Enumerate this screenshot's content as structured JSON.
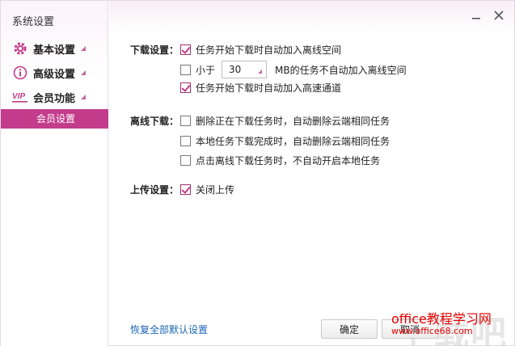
{
  "window": {
    "title": "系统设置"
  },
  "sidebar": {
    "items": [
      {
        "label": "基本设置"
      },
      {
        "label": "高级设置"
      },
      {
        "label": "会员功能"
      }
    ],
    "sub_items": [
      {
        "label": "会员设置"
      }
    ]
  },
  "settings": {
    "download": {
      "label": "下载设置：",
      "opt1": {
        "text": "任务开始下载时自动加入离线空间",
        "checked": true
      },
      "opt2": {
        "prefix": "小于",
        "value": "30",
        "suffix": "MB的任务不自动加入离线空间",
        "checked": false
      },
      "opt3": {
        "text": "任务开始下载时自动加入高速通道",
        "checked": true
      }
    },
    "offline": {
      "label": "离线下载：",
      "opt1": {
        "text": "删除正在下载任务时，自动删除云端相同任务",
        "checked": false
      },
      "opt2": {
        "text": "本地任务下载完成时，自动删除云端相同任务",
        "checked": false
      },
      "opt3": {
        "text": "点击离线下载任务时，不自动开启本地任务",
        "checked": false
      }
    },
    "upload": {
      "label": "上传设置：",
      "opt1": {
        "text": "关闭上传",
        "checked": true
      }
    }
  },
  "footer": {
    "restore_link": "恢复全部默认设置",
    "ok_label": "确定",
    "cancel_label": "取消"
  },
  "watermark": {
    "big": "下载吧",
    "site_name": "office教程学习网",
    "site_url": "www.office68.com"
  },
  "colors": {
    "accent": "#c33c8b"
  }
}
